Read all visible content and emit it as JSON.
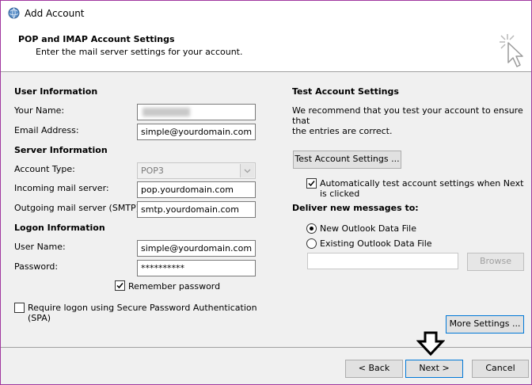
{
  "window": {
    "title": "Add Account"
  },
  "header": {
    "title": "POP and IMAP Account Settings",
    "subtitle": "Enter the mail server settings for your account."
  },
  "user_information": {
    "heading": "User Information",
    "your_name_label": "Your Name:",
    "email_label": "Email Address:",
    "email_value": "simple@yourdomain.com"
  },
  "server_information": {
    "heading": "Server Information",
    "account_type_label": "Account Type:",
    "account_type_value": "POP3",
    "incoming_label": "Incoming mail server:",
    "incoming_value": "pop.yourdomain.com",
    "outgoing_label": "Outgoing mail server (SMTP):",
    "outgoing_value": "smtp.yourdomain.com"
  },
  "logon_information": {
    "heading": "Logon Information",
    "user_name_label": "User Name:",
    "user_name_value": "simple@yourdomain.com",
    "password_label": "Password:",
    "password_value": "**********",
    "remember_label": "Remember password",
    "remember_checked": true,
    "spa_label_line1": "Require logon using Secure Password Authentication",
    "spa_label_line2": "(SPA)",
    "spa_checked": false
  },
  "test_settings": {
    "heading": "Test Account Settings",
    "description_line1": "We recommend that you test your account to ensure that",
    "description_line2": "the entries are correct.",
    "test_button": "Test Account Settings ...",
    "auto_test_line1": "Automatically test account settings when Next",
    "auto_test_line2": "is clicked",
    "auto_test_checked": true
  },
  "deliver": {
    "heading": "Deliver new messages to:",
    "new_file": "New Outlook Data File",
    "existing_file": "Existing Outlook Data File",
    "selected": "new",
    "existing_path": "",
    "browse": "Browse"
  },
  "more_settings_button": "More Settings ...",
  "footer": {
    "back": "< Back",
    "next": "Next >",
    "cancel": "Cancel"
  }
}
